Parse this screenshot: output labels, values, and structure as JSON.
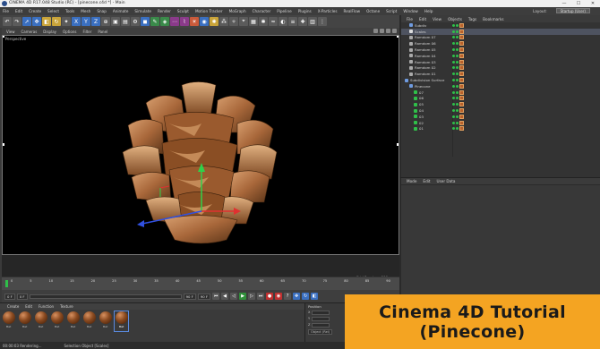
{
  "window": {
    "title": "CINEMA 4D R17.048 Studio (RC) - [pinecone.c4d *] - Main",
    "controls": [
      "—",
      "☐",
      "✕"
    ]
  },
  "menubar": {
    "items": [
      "File",
      "Edit",
      "Create",
      "Select",
      "Tools",
      "Mesh",
      "Snap",
      "Animate",
      "Simulate",
      "Render",
      "Sculpt",
      "Motion Tracker",
      "MoGraph",
      "Character",
      "Pipeline",
      "Plugins",
      "X-Particles",
      "RealFlow",
      "Octane",
      "Script",
      "Window",
      "Help"
    ],
    "layout_label": "Layout:",
    "layout_value": "Startup (User)"
  },
  "viewport": {
    "menu": [
      "View",
      "Cameras",
      "Display",
      "Options",
      "Filter",
      "Panel"
    ],
    "label": "Perspective",
    "grid_spacing": "Grid Spacing : 500 cm"
  },
  "timeline": {
    "ticks": [
      "0",
      "5",
      "10",
      "15",
      "20",
      "25",
      "30",
      "35",
      "40",
      "45",
      "50",
      "55",
      "60",
      "65",
      "70",
      "75",
      "80",
      "85",
      "90"
    ],
    "start_field": "0 F",
    "current_field": "0 F",
    "end_field": "90 F",
    "end2_field": "90 F",
    "frame_readout": "0 F"
  },
  "objects_panel": {
    "tabs": [
      "File",
      "Edit",
      "View",
      "Objects",
      "Tags",
      "Bookmarks"
    ],
    "items": [
      {
        "label": "Subdiv",
        "indent": 1,
        "color": "#6f9be0"
      },
      {
        "label": "Scales",
        "indent": 1,
        "color": "#dddddd"
      },
      {
        "label": "Ramdom 07",
        "indent": 1,
        "color": "#aaaaaa"
      },
      {
        "label": "Ramdom 06",
        "indent": 1,
        "color": "#aaaaaa"
      },
      {
        "label": "Ramdom 05",
        "indent": 1,
        "color": "#aaaaaa"
      },
      {
        "label": "Ramdom 04",
        "indent": 1,
        "color": "#aaaaaa"
      },
      {
        "label": "Ramdom 03",
        "indent": 1,
        "color": "#aaaaaa"
      },
      {
        "label": "Ramdom 02",
        "indent": 1,
        "color": "#aaaaaa"
      },
      {
        "label": "Ramdom 01",
        "indent": 1,
        "color": "#aaaaaa"
      },
      {
        "label": "Subdivision Surface",
        "indent": 0,
        "color": "#6f9be0"
      },
      {
        "label": "Pinecone",
        "indent": 1,
        "color": "#6f9be0"
      },
      {
        "label": "07",
        "indent": 2,
        "color": "#2fbf49"
      },
      {
        "label": "06",
        "indent": 2,
        "color": "#2fbf49"
      },
      {
        "label": "05",
        "indent": 2,
        "color": "#2fbf49"
      },
      {
        "label": "04",
        "indent": 2,
        "color": "#2fbf49"
      },
      {
        "label": "03",
        "indent": 2,
        "color": "#2fbf49"
      },
      {
        "label": "02",
        "indent": 2,
        "color": "#2fbf49"
      },
      {
        "label": "01",
        "indent": 2,
        "color": "#2fbf49"
      }
    ]
  },
  "attributes_panel": {
    "tabs": [
      "Mode",
      "Edit",
      "User Data"
    ]
  },
  "materials": {
    "tabs": [
      "Create",
      "Edit",
      "Function",
      "Texture"
    ],
    "items": [
      "Mat",
      "Mat",
      "Mat",
      "Mat",
      "Mat",
      "Mat",
      "Mat",
      "Mat"
    ]
  },
  "coordinates": {
    "header": "Position",
    "rows": [
      "X",
      "Y",
      "Z"
    ],
    "mode": "Object (Rel)"
  },
  "statusbar": {
    "time": "00:00:03 Rendering...",
    "message": "Selection Object [Scales]"
  },
  "banner": {
    "line1": "Cinema 4D Tutorial",
    "line2": "(Pinecone)"
  },
  "colors": {
    "banner_bg": "#f4a422",
    "selection_blue": "#4e5360"
  }
}
